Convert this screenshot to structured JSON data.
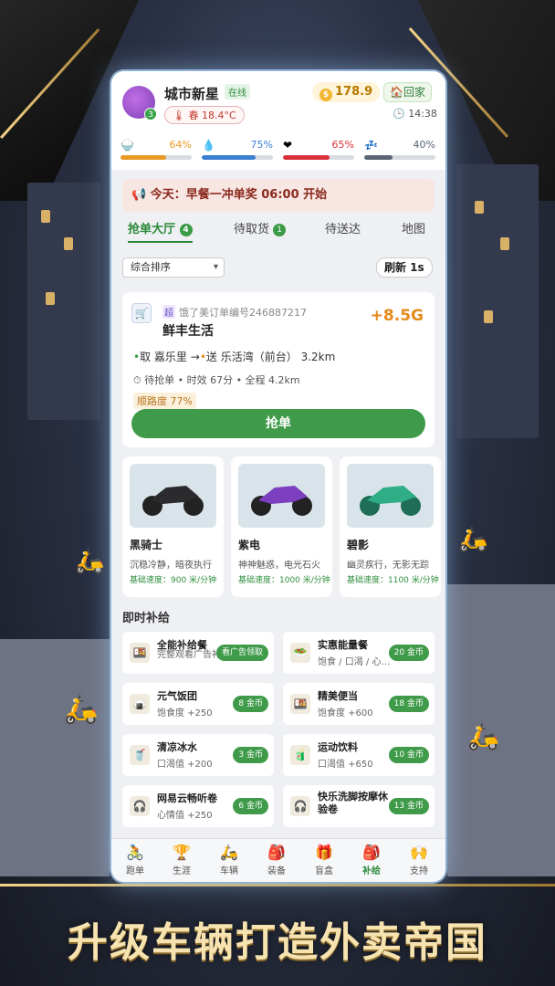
{
  "profile": {
    "username": "城市新星",
    "status": "在线",
    "level": "3",
    "weather": "春 18.4°C",
    "coins": "178.9",
    "home_label": "回家",
    "time": "14:38"
  },
  "stats": [
    {
      "icon": "food-bowl-icon",
      "glyph": "🍚",
      "value": "64%",
      "fraction": 0.64,
      "color": "#e89a22"
    },
    {
      "icon": "water-drop-icon",
      "glyph": "💧",
      "value": "75%",
      "fraction": 0.75,
      "color": "#3b7fd0"
    },
    {
      "icon": "heart-icon",
      "glyph": "❤",
      "value": "65%",
      "fraction": 0.65,
      "color": "#d9303a"
    },
    {
      "icon": "sleep-icon",
      "glyph": "💤",
      "value": "40%",
      "fraction": 0.4,
      "color": "#5a6578"
    }
  ],
  "notice": "今天：早餐一冲单奖 06:00 开始",
  "tabs": [
    {
      "label": "抢单大厅",
      "badge": "4"
    },
    {
      "label": "待取货",
      "badge": "1"
    },
    {
      "label": "待送达",
      "badge": ""
    },
    {
      "label": "地图",
      "badge": ""
    }
  ],
  "sort": {
    "selected": "综合排序"
  },
  "refresh_label": "刷新 1s",
  "order": {
    "super_tag": "超",
    "order_number": "饿了美订单编号246887217",
    "store": "鲜丰生活",
    "reward": "+8.5G",
    "pickup_prefix": "取",
    "pickup": "嘉乐里",
    "arrow": "→",
    "dropoff_prefix": "送",
    "dropoff": "乐活湾（前台） 3.2km",
    "meta": "待抢单 • 时效 67分 • 全程 4.2km",
    "smoothness": "顺路度 77%",
    "grab_label": "抢单"
  },
  "vehicles": [
    {
      "name": "黑骑士",
      "desc": "沉稳冷静，暗夜执行",
      "speed": "基础速度：900 米/分钟",
      "color": "#2b2b2e"
    },
    {
      "name": "紫电",
      "desc": "神神魅惑，电光石火",
      "speed": "基础速度：1000 米/分钟",
      "color": "#7c3fbf"
    },
    {
      "name": "碧影",
      "desc": "幽灵疾行，无影无踪",
      "speed": "基础速度：1100 米/分钟",
      "color": "#2fae86"
    }
  ],
  "supply_title": "即时补给",
  "supplies": [
    {
      "name": "全能补给餐",
      "effect": "完整观看广告补满",
      "button": "看广告领取",
      "icon": "bento-icon",
      "glyph": "🍱"
    },
    {
      "name": "实惠能量餐",
      "effect": "饱食 / 口渴 / 心…",
      "button": "20 金币",
      "icon": "salad-icon",
      "glyph": "🥗"
    },
    {
      "name": "元气饭团",
      "effect": "饱食度 +250",
      "button": "8 金币",
      "icon": "rice-ball-icon",
      "glyph": "🍙"
    },
    {
      "name": "精美便当",
      "effect": "饱食度 +600",
      "button": "18 金币",
      "icon": "lunchbox-icon",
      "glyph": "🍱"
    },
    {
      "name": "清凉冰水",
      "effect": "口渴值 +200",
      "button": "3 金币",
      "icon": "water-cup-icon",
      "glyph": "🥤"
    },
    {
      "name": "运动饮料",
      "effect": "口渴值 +650",
      "button": "10 金币",
      "icon": "sports-drink-icon",
      "glyph": "🧃"
    },
    {
      "name": "网易云畅听卷",
      "effect": "心情值 +250",
      "button": "6 金币",
      "icon": "headphones-icon",
      "glyph": "🎧"
    },
    {
      "name": "快乐洗脚按摩休验卷",
      "effect": "",
      "button": "13 金币",
      "icon": "headphones-icon",
      "glyph": "🎧"
    }
  ],
  "nav": [
    {
      "label": "跑单",
      "glyph": "🚴"
    },
    {
      "label": "生涯",
      "glyph": "🏆"
    },
    {
      "label": "车辆",
      "glyph": "🛵"
    },
    {
      "label": "装备",
      "glyph": "🎒"
    },
    {
      "label": "盲盒",
      "glyph": "🎁"
    },
    {
      "label": "补给",
      "glyph": "🎒"
    },
    {
      "label": "支持",
      "glyph": "🙌"
    }
  ],
  "nav_active": 5,
  "tagline": "升级车辆打造外卖帝国"
}
